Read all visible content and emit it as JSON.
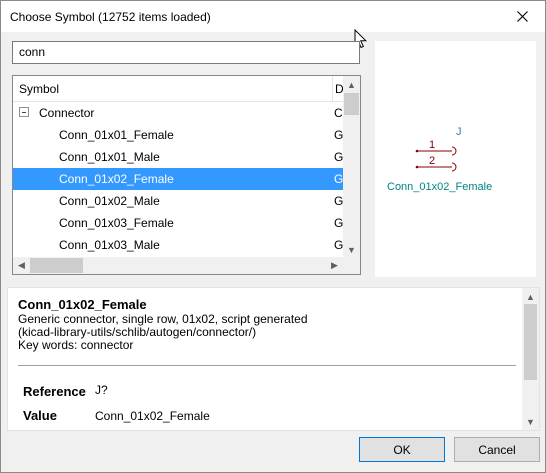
{
  "window": {
    "title": "Choose Symbol (12752 items loaded)"
  },
  "search": {
    "value": "conn"
  },
  "tree": {
    "columns": {
      "symbol": "Symbol",
      "description": "D"
    },
    "rows": [
      {
        "name": "Connector",
        "desc": "C",
        "level": 0,
        "expanded": true,
        "selected": false
      },
      {
        "name": "Conn_01x01_Female",
        "desc": "G",
        "level": 1,
        "selected": false
      },
      {
        "name": "Conn_01x01_Male",
        "desc": "G",
        "level": 1,
        "selected": false
      },
      {
        "name": "Conn_01x02_Female",
        "desc": "G",
        "level": 1,
        "selected": true
      },
      {
        "name": "Conn_01x02_Male",
        "desc": "G",
        "level": 1,
        "selected": false
      },
      {
        "name": "Conn_01x03_Female",
        "desc": "G",
        "level": 1,
        "selected": false
      },
      {
        "name": "Conn_01x03_Male",
        "desc": "G",
        "level": 1,
        "selected": false
      }
    ]
  },
  "preview": {
    "reference": "J",
    "pin1": "1",
    "pin2": "2",
    "value": "Conn_01x02_Female",
    "colors": {
      "ref": "#2f7fbf",
      "value": "#008484",
      "pin": "#840000"
    }
  },
  "info": {
    "title": "Conn_01x02_Female",
    "line1": "Generic connector, single row, 01x02, script generated",
    "line2": "(kicad-library-utils/schlib/autogen/connector/)",
    "line3": "Key words: connector",
    "reference_label": "Reference",
    "reference_value": "J?",
    "value_label": "Value",
    "value_value": "Conn_01x02_Female"
  },
  "buttons": {
    "ok": "OK",
    "cancel": "Cancel"
  },
  "colors": {
    "selection": "#3399ff",
    "default_button_border": "#0078d7"
  }
}
